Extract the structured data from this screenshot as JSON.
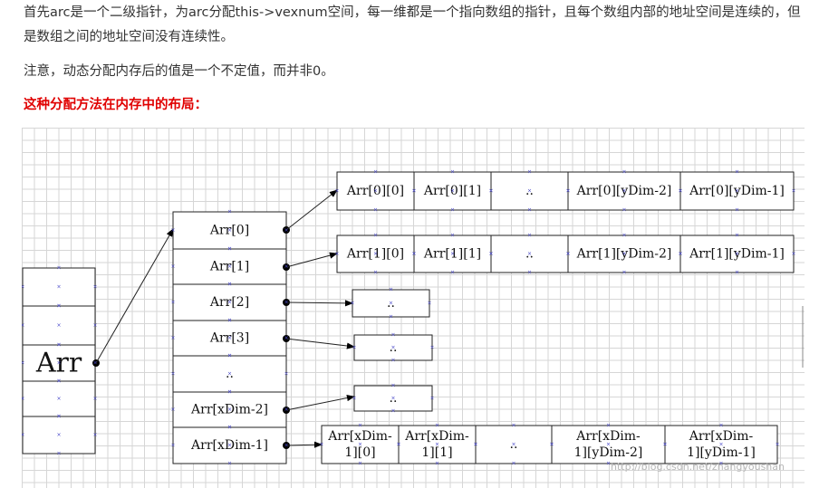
{
  "text": {
    "para1": "首先arc是一个二级指针，为arc分配this->vexnum空间，每一维都是一个指向数组的指针，且每个数组内部的地址空间是连续的，但是数组之间的地址空间没有连续性。",
    "para2": "注意，动态分配内存后的值是一个不定值，而并非0。",
    "heading": "这种分配方法在内存中的布局："
  },
  "diagram": {
    "arr_label": "Arr",
    "pointer_cells": [
      "Arr[0]",
      "Arr[1]",
      "Arr[2]",
      "Arr[3]",
      "..",
      "Arr[xDim-2]",
      "Arr[xDim-1]"
    ],
    "row0": [
      "Arr[0][0]",
      "Arr[0][1]",
      "..",
      "Arr[0][yDim-2]",
      "Arr[0][yDim-1]"
    ],
    "row1": [
      "Arr[1][0]",
      "Arr[1][1]",
      "..",
      "Arr[1][yDim-2]",
      "Arr[1][yDim-1]"
    ],
    "row2": [
      ".."
    ],
    "row3": [
      ".."
    ],
    "row_xm2": [
      ".."
    ],
    "row_last": [
      [
        "Arr[xDim-",
        "1][0]"
      ],
      [
        "Arr[xDim-",
        "1][1]"
      ],
      [
        ".."
      ],
      [
        "Arr[xDim-",
        "1][yDim-2]"
      ],
      [
        "Arr[xDim-",
        "1][yDim-1]"
      ]
    ],
    "watermark": "http://blog.csdn.net/zhangyoushan"
  }
}
